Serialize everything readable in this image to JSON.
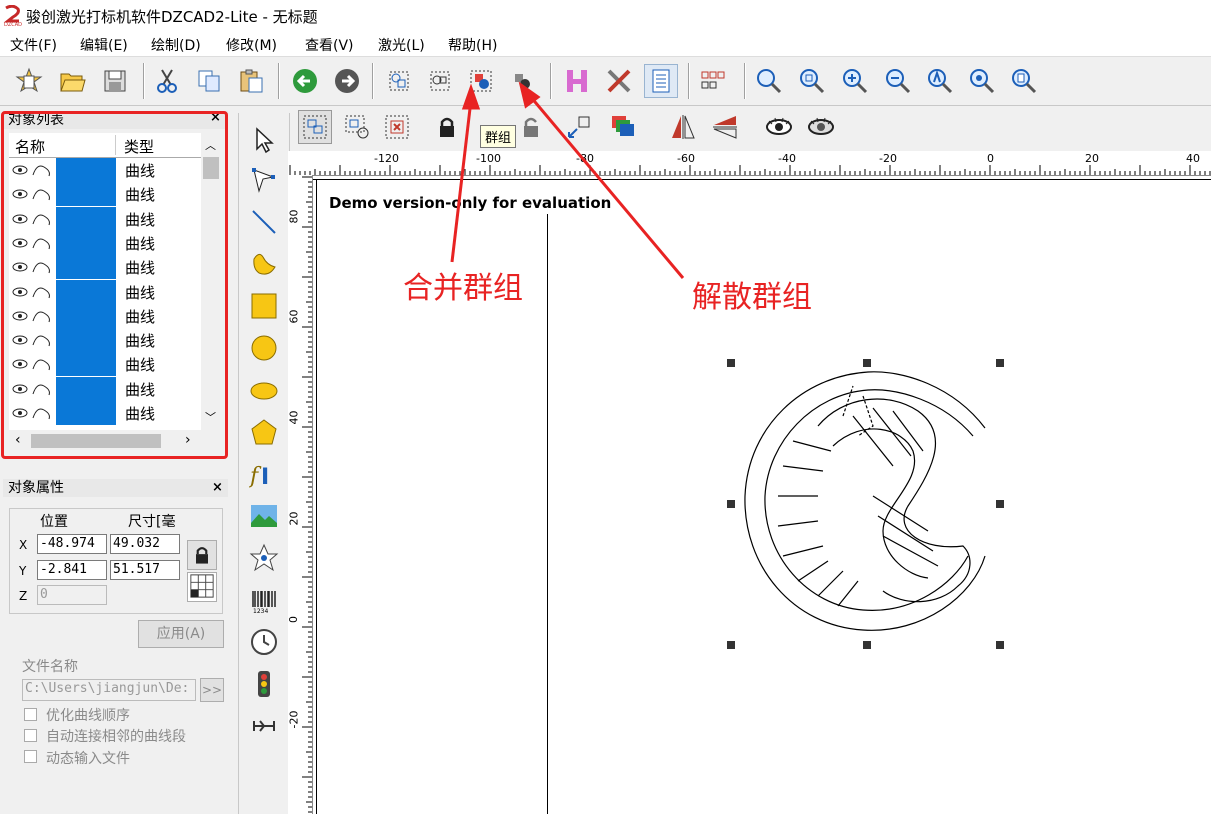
{
  "window": {
    "title": "骏创激光打标机软件DZCAD2-Lite  - 无标题"
  },
  "menu": [
    "文件(F)",
    "编辑(E)",
    "绘制(D)",
    "修改(M)",
    "查看(V)",
    "激光(L)",
    "帮助(H)"
  ],
  "toolbar_main": [
    "new-icon",
    "open-icon",
    "save-icon",
    "cut-icon",
    "copy-icon",
    "paste-icon",
    "undo-icon",
    "redo-icon",
    "select-node-icon",
    "group-select-icon",
    "merge-group-icon",
    "ungroup-icon",
    "hatch-icon",
    "tools-icon",
    "properties-icon",
    "array-icon",
    "zoom-icon",
    "zoom-in-icon",
    "zoom-plus-icon",
    "zoom-minus-icon",
    "zoom-all-icon",
    "zoom-fit-icon",
    "zoom-page-icon"
  ],
  "tooltip": "群组",
  "object_list": {
    "caption": "对象列表",
    "close": "×",
    "columns": [
      "名称",
      "类型"
    ],
    "rows": [
      "曲线",
      "曲线",
      "曲线",
      "曲线",
      "曲线",
      "曲线",
      "曲线",
      "曲线",
      "曲线",
      "曲线",
      "曲线"
    ]
  },
  "properties": {
    "caption": "对象属性",
    "close": "×",
    "position_label": "位置",
    "size_label": "尺寸[毫",
    "x_label": "X",
    "y_label": "Y",
    "z_label": "Z",
    "x_pos": "-48.974",
    "x_size": "49.032",
    "y_pos": "-2.841",
    "y_size": "51.517",
    "z_pos": "0",
    "apply": "应用(A)",
    "file_name_label": "文件名称",
    "file_path": "C:\\Users\\jiangjun\\De:",
    "browse": ">>",
    "opt1": "优化曲线顺序",
    "opt2": "自动连接相邻的曲线段",
    "opt3": "动态输入文件"
  },
  "ruler_top": [
    "-120",
    "-100",
    "-80",
    "-60",
    "-40",
    "-20",
    "0",
    "20",
    "40"
  ],
  "ruler_left": [
    "80",
    "60",
    "40",
    "20",
    "0",
    "-20"
  ],
  "canvas": {
    "watermark": "Demo version-only for evaluation"
  },
  "annotations": {
    "merge": "合并群组",
    "ungroup": "解散群组"
  }
}
